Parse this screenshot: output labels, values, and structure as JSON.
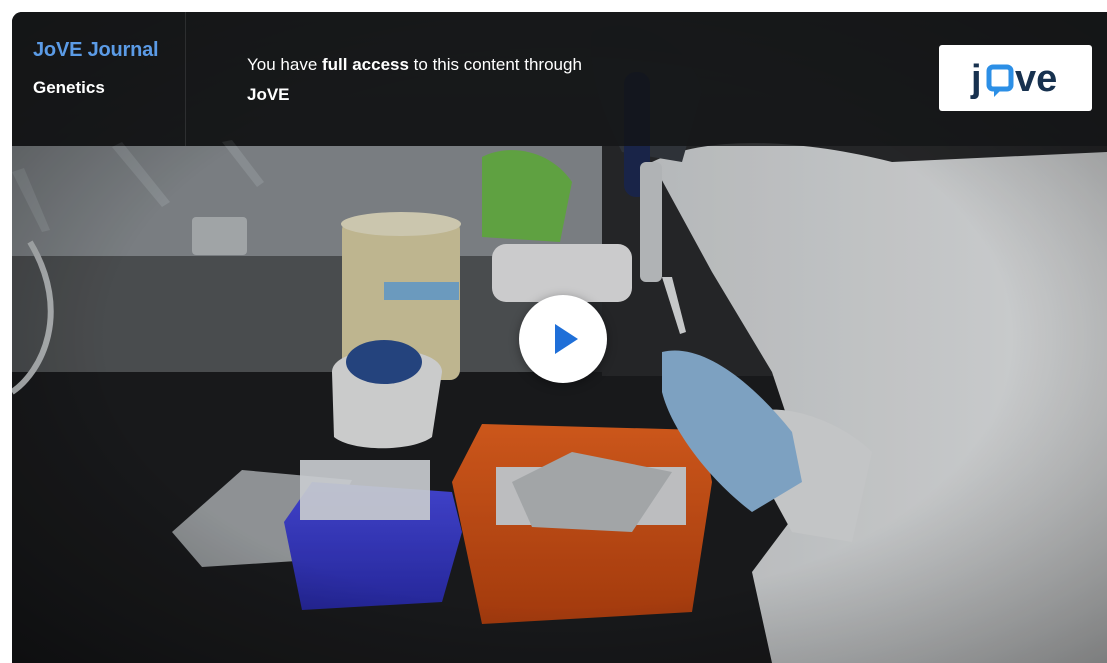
{
  "header": {
    "journal_title": "JoVE Journal",
    "section": "Genetics",
    "access_prefix": "You have ",
    "access_emphasis": "full access",
    "access_suffix": " to this content through",
    "access_institution": "JoVE"
  },
  "logo": {
    "text_before": "j",
    "text_after": "ve",
    "icon": "speech-bubble-icon"
  },
  "video": {
    "play_icon": "play-icon",
    "thumbnail_subject": "lab scientist pipetting into 96-well plate"
  },
  "colors": {
    "journal_title": "#5b9be6",
    "play_icon": "#1f6fd8",
    "logo_text": "#17314f",
    "gloves": "#8fb8dc",
    "ice_bucket": "#e0571e",
    "tip_box": "#3d3fd6"
  }
}
